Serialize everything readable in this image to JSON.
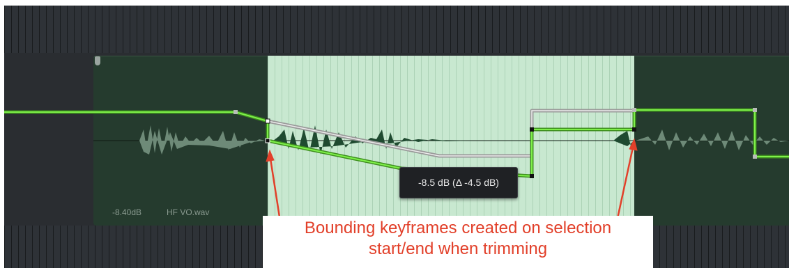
{
  "clip": {
    "gain_label": "-8.40dB",
    "name": "HF VO.wav"
  },
  "tooltip": {
    "text": "-8.5 dB (Δ -4.5 dB)"
  },
  "annotation": {
    "line1": "Bounding keyframes created on selection",
    "line2": "start/end when trimming"
  },
  "colors": {
    "track_background": "#2a2d31",
    "clip_fill": "#253b2e",
    "selection_fill": "#c8e8d0",
    "volume_curve": "#5bd02a",
    "ghost_curve": "#9a9a9a",
    "annotation_text": "#e2402a"
  },
  "icons": {
    "clip_handle": "clip-trim-handle-icon",
    "keyframe": "keyframe-point-icon",
    "arrow": "callout-arrow-icon"
  }
}
